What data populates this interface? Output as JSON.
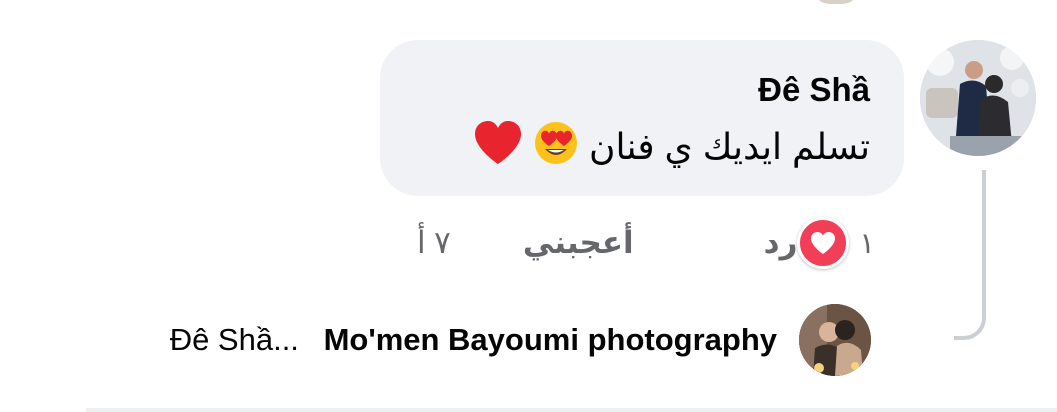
{
  "comment": {
    "author": "Đê Shầ",
    "text": "تسلم ايديك ي فنان",
    "emojis": [
      "heart-eyes-emoji",
      "red-heart-emoji"
    ]
  },
  "actions": {
    "time": "٧ أ",
    "like_label": "أعجبني",
    "reply_label": "رد",
    "reaction": {
      "type": "love",
      "count": "١",
      "color": "#f33e58"
    }
  },
  "reply_preview": {
    "author": "Mo'men Bayoumi photography",
    "snippet": "Đê Shầ..."
  },
  "colors": {
    "bubble": "#f0f2f5",
    "meta_text": "#65676b",
    "thread_line": "#ccd0d5",
    "primary_text": "#050505"
  }
}
